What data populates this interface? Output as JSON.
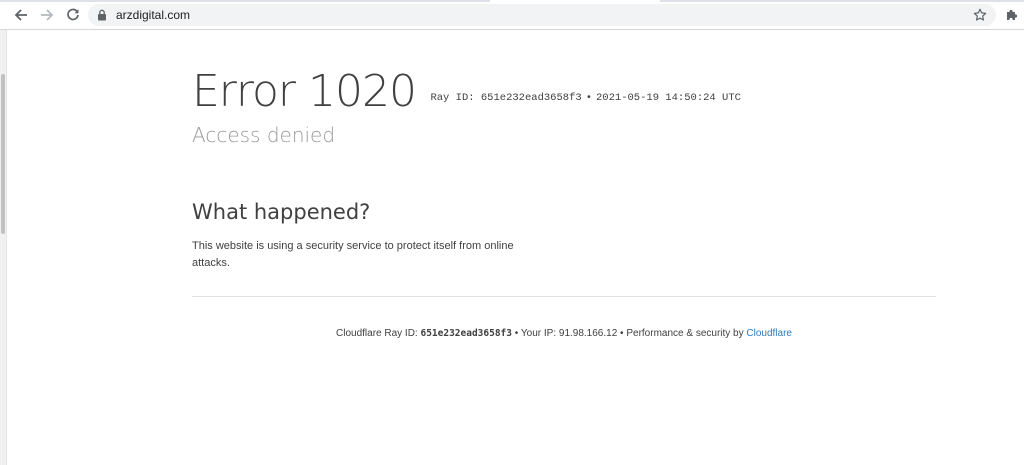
{
  "browser": {
    "url": "arzdigital.com",
    "icons": {
      "back": "arrow-left-icon",
      "forward": "arrow-right-icon",
      "reload": "reload-icon",
      "lock": "lock-icon",
      "bookmark": "star-icon",
      "extensions": "puzzle-icon"
    }
  },
  "page": {
    "error_title": "Error 1020",
    "ray_label": "Ray ID: 651e232ead3658f3",
    "ray_sep": "•",
    "timestamp": "2021-05-19 14:50:24 UTC",
    "subtitle": "Access denied",
    "section_heading": "What happened?",
    "section_body": "This website is using a security service to protect itself from online attacks."
  },
  "footer": {
    "ray_prefix": "Cloudflare Ray ID: ",
    "ray_id": "651e232ead3658f3",
    "sep1": " • ",
    "ip_text": "Your IP: 91.98.166.12",
    "sep2": " • ",
    "perf_text": "Performance & security by ",
    "cloudflare_link": "Cloudflare"
  },
  "colors": {
    "link": "#2f7bbf",
    "text": "#404040",
    "subtitle": "#999999"
  }
}
